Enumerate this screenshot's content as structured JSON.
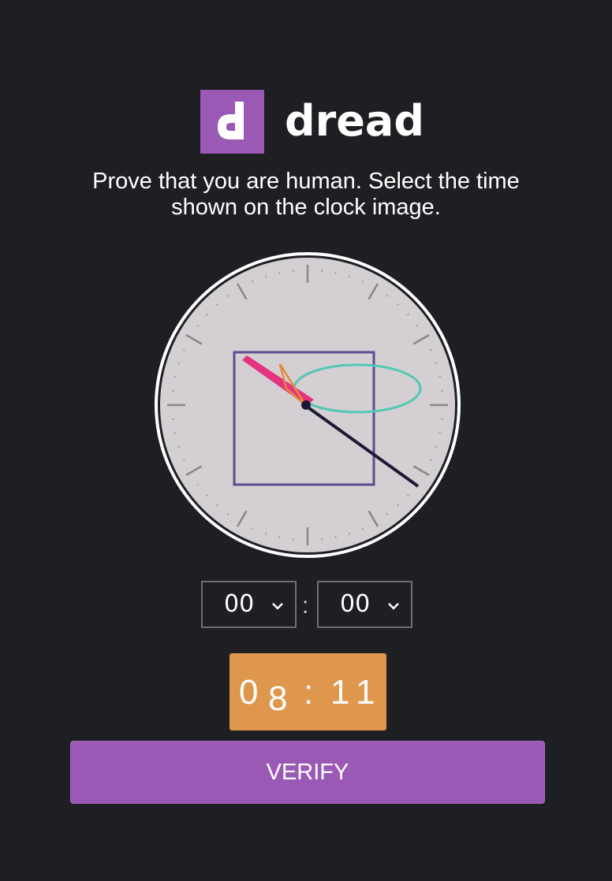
{
  "brand": {
    "logo_letter": "d",
    "name": "dread",
    "accent_color": "#9b59b6"
  },
  "prompt": {
    "line1": "Prove that you are human. Select the time",
    "line2": "shown on the clock image."
  },
  "clock": {
    "face_color": "#d4cfd3",
    "decoy_shapes": [
      "rectangle",
      "ellipse",
      "triangle",
      "pink-bar"
    ]
  },
  "time_picker": {
    "hours_value": "00",
    "minutes_value": "00",
    "separator": ":",
    "chevron_icon": "chevron-down-icon"
  },
  "captcha_code": {
    "chars": [
      "0",
      "8",
      ":",
      "1",
      "1"
    ],
    "background_color": "#de974d"
  },
  "verify_button": {
    "label": "VERIFY"
  }
}
